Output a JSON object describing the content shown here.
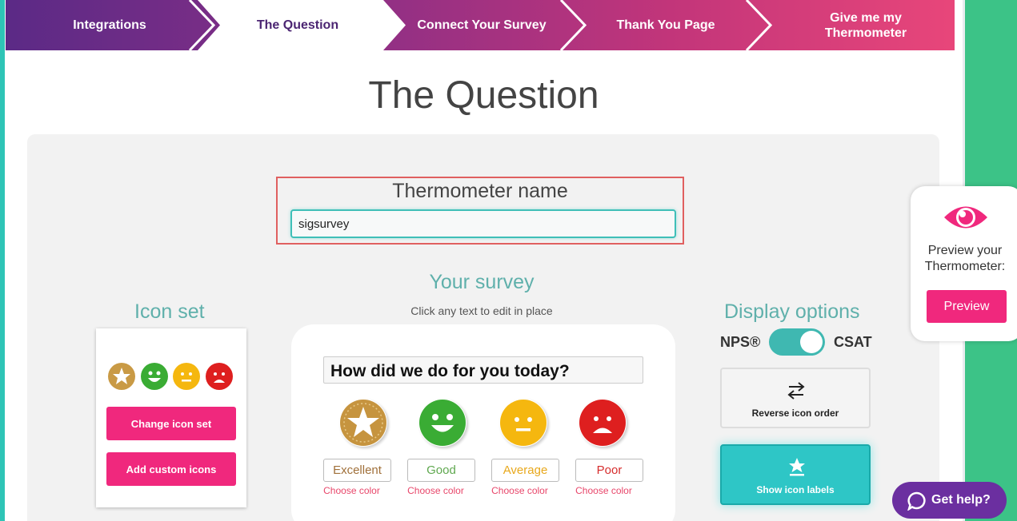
{
  "steps": [
    {
      "label": "Integrations"
    },
    {
      "label": "The Question"
    },
    {
      "label": "Connect Your Survey"
    },
    {
      "label": "Thank You Page"
    },
    {
      "label": "Give me my Thermometer"
    }
  ],
  "page_title": "The Question",
  "thermometer": {
    "label": "Thermometer name",
    "value": "sigsurvey"
  },
  "icon_set": {
    "heading": "Icon set",
    "change_button": "Change icon set",
    "custom_button": "Add custom icons",
    "icons": [
      "star-icon",
      "smile-icon",
      "neutral-icon",
      "sad-icon"
    ]
  },
  "survey": {
    "heading": "Your survey",
    "note": "Click any text to edit in place",
    "question": "How did we do for you today?",
    "choose_color": "Choose color",
    "answers": [
      {
        "label": "Excellent",
        "icon": "star-icon",
        "color": "#b8873a"
      },
      {
        "label": "Good",
        "icon": "smile-icon",
        "color": "#3aac34"
      },
      {
        "label": "Average",
        "icon": "neutral-icon",
        "color": "#f5b70f"
      },
      {
        "label": "Poor",
        "icon": "sad-icon",
        "color": "#de1f1f"
      }
    ]
  },
  "display": {
    "heading": "Display options",
    "nps": "NPS®",
    "csat": "CSAT",
    "reverse": "Reverse icon order",
    "show_labels": "Show icon labels"
  },
  "preview": {
    "text": "Preview your Thermometer:",
    "button": "Preview"
  },
  "help": {
    "label": "Get help?"
  }
}
